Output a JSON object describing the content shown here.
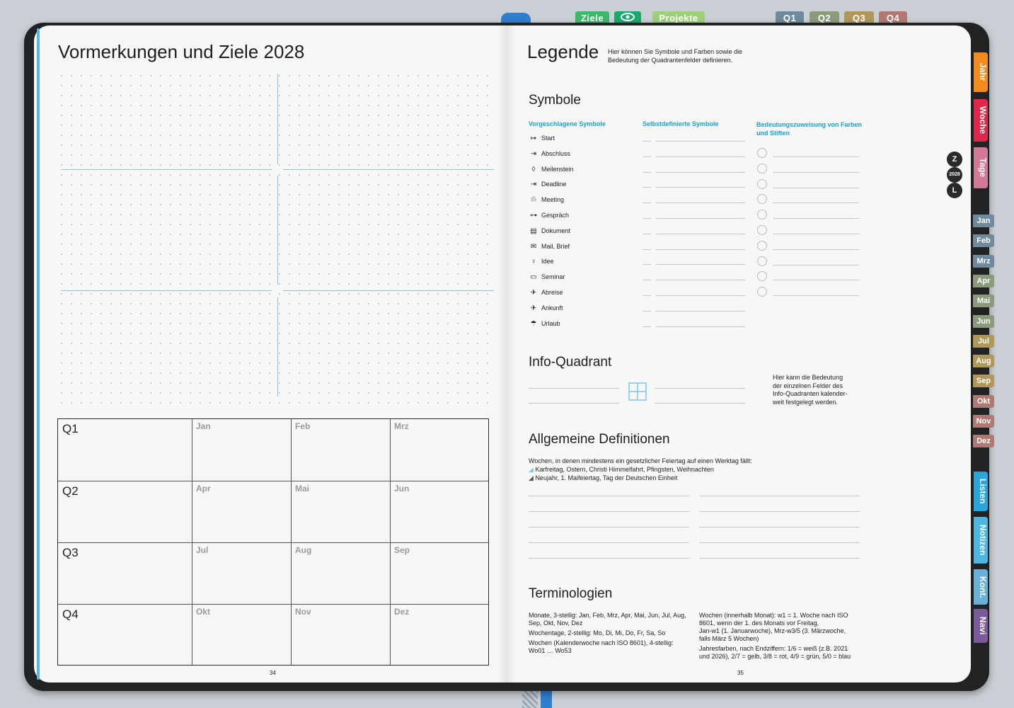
{
  "top_tabs": {
    "ziele": "Ziele",
    "projekte": "Projekte",
    "q1": "Q1",
    "q2": "Q2",
    "q3": "Q3",
    "q4": "Q4"
  },
  "left": {
    "title": "Vormerkungen und Ziele 2028",
    "quarters": [
      {
        "label": "Q1",
        "months": [
          "Jan",
          "Feb",
          "Mrz"
        ]
      },
      {
        "label": "Q2",
        "months": [
          "Apr",
          "Mai",
          "Jun"
        ]
      },
      {
        "label": "Q3",
        "months": [
          "Jul",
          "Aug",
          "Sep"
        ]
      },
      {
        "label": "Q4",
        "months": [
          "Okt",
          "Nov",
          "Dez"
        ]
      }
    ],
    "page_number": "34"
  },
  "right": {
    "title": "Legende",
    "subtitle_line1": "Hier können Sie Symbole und Farben sowie die",
    "subtitle_line2": "Bedeutung der Quadrantenfelder definieren.",
    "symbols_heading": "Symbole",
    "col1": "Vorgeschlagene Symbole",
    "col2": "Selbstdefinierte Symbole",
    "col3_line1": "Bedeutungszuweisung von Farben",
    "col3_line2": "und Stiften",
    "symbols": [
      {
        "icon": "↦",
        "label": "Start"
      },
      {
        "icon": "⇥",
        "label": "Abschluss"
      },
      {
        "icon": "◊",
        "label": "Meilenstein"
      },
      {
        "icon": "⇥",
        "label": "Deadline"
      },
      {
        "icon": "♲",
        "label": "Meeting"
      },
      {
        "icon": "⊶",
        "label": "Gespräch"
      },
      {
        "icon": "▤",
        "label": "Dokument"
      },
      {
        "icon": "✉",
        "label": "Mail, Brief"
      },
      {
        "icon": "♀",
        "label": "Idee"
      },
      {
        "icon": "▭",
        "label": "Seminar"
      },
      {
        "icon": "✈",
        "label": "Abreise"
      },
      {
        "icon": "✈",
        "label": "Ankunft"
      },
      {
        "icon": "☂",
        "label": "Urlaub"
      }
    ],
    "info_heading": "Info-Quadrant",
    "info_text": [
      "Hier kann die Bedeutung",
      "der einzelnen Felder des",
      "Info-Quadranten kalender-",
      "weit festgelegt werden."
    ],
    "defs_heading": "Allgemeine Definitionen",
    "defs_intro": "Wochen, in denen mindestens ein gesetzlicher Feiertag auf einen Werktag fällt:",
    "defs_item1": "Karfreitag, Ostern, Christi Himmelfahrt, Pfingsten, Weihnachten",
    "defs_item2": "Neujahr, 1. Maifeiertag, Tag der Deutschen Einheit",
    "term_heading": "Terminologien",
    "term_left": [
      "Monate, 3-stellig: Jan, Feb, Mrz, Apr, Mai, Jun, Jul, Aug,",
      "Sep, Okt, Nov, Dez",
      "Wochentage, 2-stellig: Mo, Di, Mi, Do, Fr, Sa, So",
      "Wochen (Kalenderwoche nach ISO 8601), 4-stellig:",
      "Wo01 … Wo53"
    ],
    "term_right": [
      "Wochen (innerhalb Monat): w1 = 1. Woche nach ISO",
      "8601, wenn der 1. des Monats vor Freitag,",
      "Jan-w1 (1. Januarwoche), Mrz-w3/5 (3. Märzwoche,",
      "falls März 5 Wochen)",
      "Jahresfarben, nach Endziffern: 1/6 = weiß (z.B. 2021",
      "und 2026), 2/7 = gelb, 3/8 = rot, 4/9 = grün, 5/0 = blau"
    ],
    "page_number": "35"
  },
  "side_tabs": {
    "jahr": "Jahr",
    "woche": "Woche",
    "tage": "Tage",
    "listen": "Listen",
    "notizen": "Notizen",
    "kont": "Kont.",
    "navi": "Navi",
    "z": "Z",
    "year": "2028",
    "l": "L",
    "months": [
      "Jan",
      "Feb",
      "Mrz",
      "Apr",
      "Mai",
      "Jun",
      "Jul",
      "Aug",
      "Sep",
      "Okt",
      "Nov",
      "Dez"
    ]
  },
  "colors": {
    "ziele": "#3cb86a",
    "eye": "#19a86e",
    "projekte": "#9ed07a",
    "q1": "#6f8a9a",
    "q2": "#8a9a7a",
    "q3": "#b0985a",
    "q4": "#b07a72",
    "jahr": "#f28a1e",
    "woche": "#e0294a",
    "tage": "#d07a96",
    "listen": "#2aa6d8",
    "notizen": "#4cb6e0",
    "kont": "#6bb0d6",
    "navi": "#7a5a9a"
  }
}
